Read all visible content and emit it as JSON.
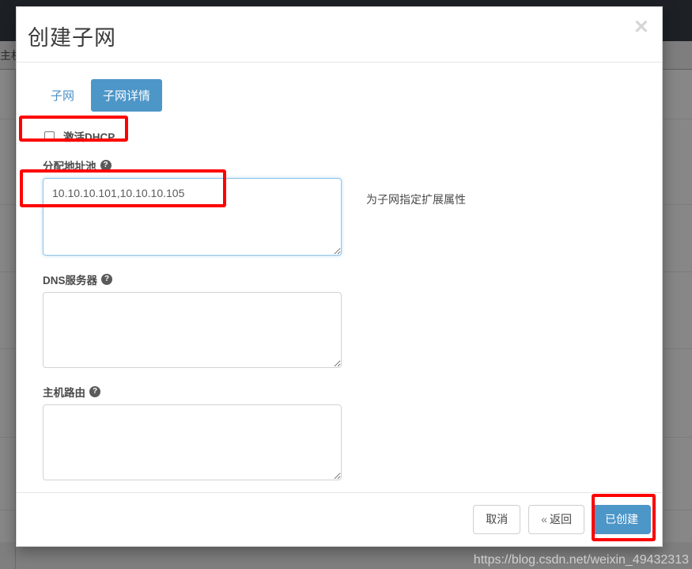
{
  "background": {
    "subbar_label": "主机"
  },
  "modal": {
    "title": "创建子网",
    "close_icon": "close-icon",
    "close_glyph": "✕",
    "tabs": [
      {
        "label": "子网",
        "active": false
      },
      {
        "label": "子网详情",
        "active": true
      }
    ],
    "dhcp": {
      "label": "激活DHCP",
      "checked": false
    },
    "fields": [
      {
        "key": "allocation_pool",
        "label": "分配地址池",
        "help_glyph": "?",
        "value": "10.10.10.101,10.10.10.105",
        "placeholder": "",
        "focused": true
      },
      {
        "key": "dns_servers",
        "label": "DNS服务器",
        "help_glyph": "?",
        "value": "",
        "placeholder": "",
        "focused": false
      },
      {
        "key": "host_routes",
        "label": "主机路由",
        "help_glyph": "?",
        "value": "",
        "placeholder": "",
        "focused": false
      }
    ],
    "help_text": "为子网指定扩展属性",
    "footer": {
      "cancel_label": "取消",
      "back_chevron": "«",
      "back_label": "返回",
      "create_label": "已创建"
    }
  },
  "annotations": [
    {
      "name": "dhcp-checkbox-highlight",
      "color": "#fe0000"
    },
    {
      "name": "allocation-pool-highlight",
      "color": "#fe0000"
    },
    {
      "name": "create-button-highlight",
      "color": "#fe0000"
    }
  ],
  "watermark": "https://blog.csdn.net/weixin_49432313",
  "colors": {
    "accent_blue": "#4d96c8",
    "link_blue": "#4a90c8",
    "annotation_red": "#fe0000",
    "overlay_gray": "#8b8b8b",
    "topbar_dark": "#1d2126"
  }
}
